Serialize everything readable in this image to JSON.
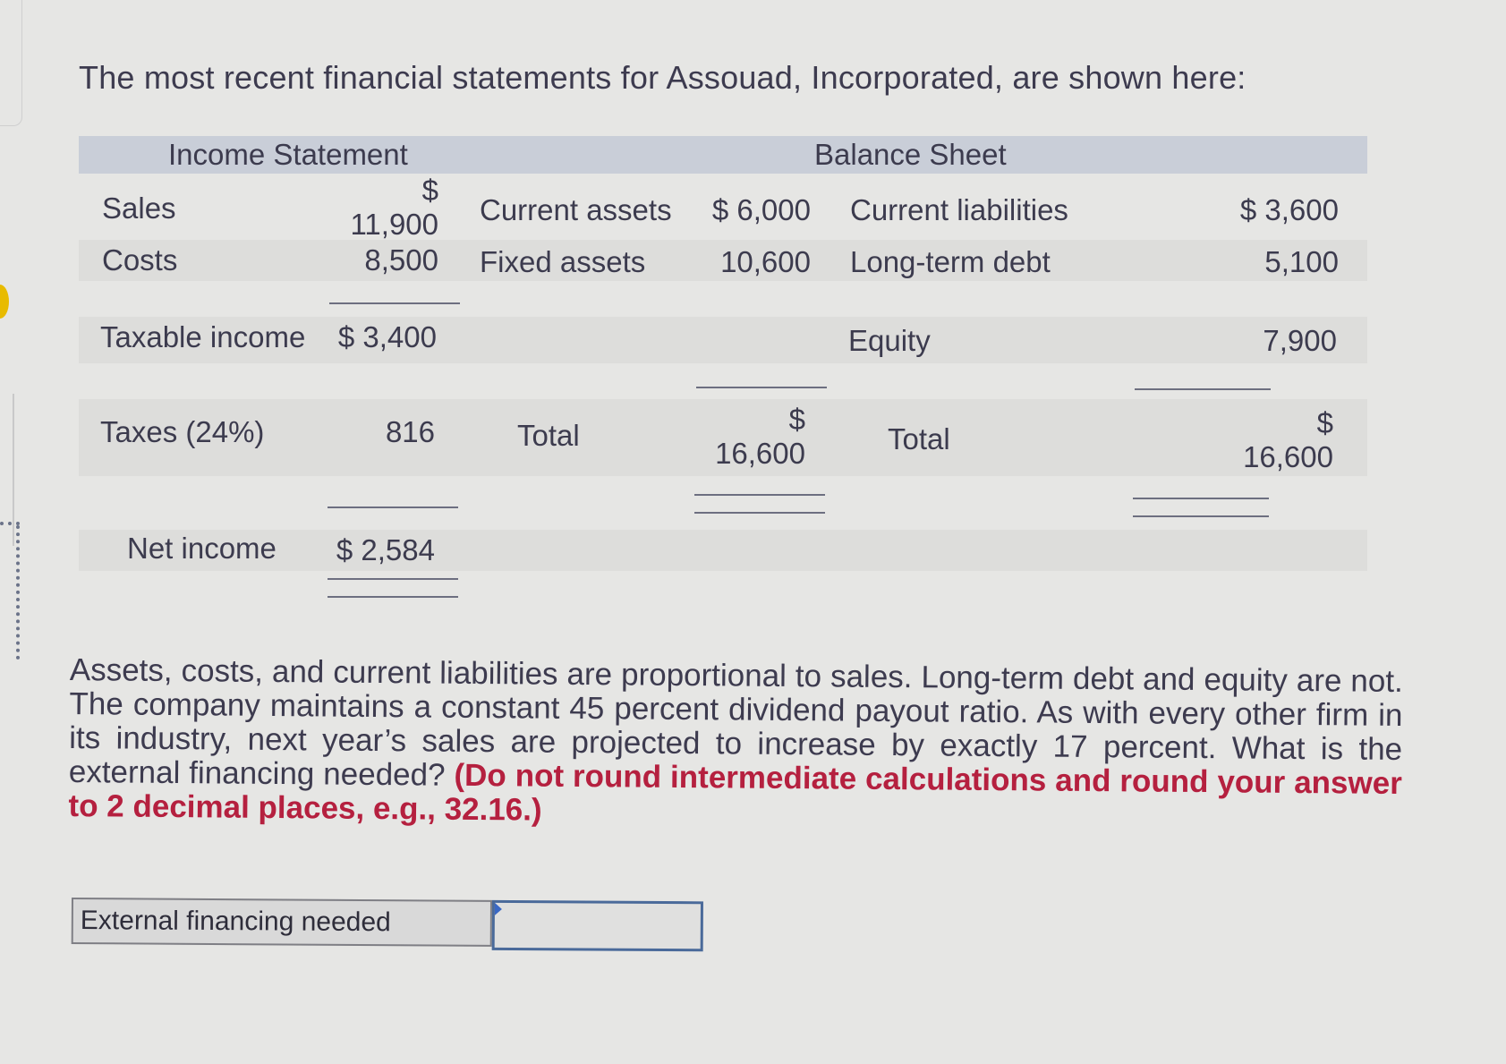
{
  "intro": "The most recent financial statements for Assouad, Incorporated, are shown here:",
  "income_statement": {
    "header": "Income Statement",
    "rows": [
      {
        "label": "Sales",
        "currency": "$",
        "value": "11,900"
      },
      {
        "label": "Costs",
        "value": "8,500"
      },
      {
        "label": "Taxable income",
        "value": "$ 3,400"
      },
      {
        "label": "Taxes (24%)",
        "value": "816"
      },
      {
        "label": "Net income",
        "value": "$ 2,584"
      }
    ]
  },
  "balance_sheet": {
    "header": "Balance Sheet",
    "assets": [
      {
        "label": "Current assets",
        "value": "$ 6,000"
      },
      {
        "label": "Fixed assets",
        "value": "10,600"
      }
    ],
    "assets_total": {
      "label": "Total",
      "currency": "$",
      "value": "16,600"
    },
    "liabilities": [
      {
        "label": "Current liabilities",
        "value": "$ 3,600"
      },
      {
        "label": "Long-term debt",
        "value": "5,100"
      },
      {
        "label": "Equity",
        "value": "7,900"
      }
    ],
    "liabilities_total": {
      "label": "Total",
      "currency": "$",
      "value": "16,600"
    }
  },
  "question": {
    "text": "Assets, costs, and current liabilities are proportional to sales. Long-term debt and equity are not. The company maintains a constant 45 percent dividend payout ratio. As with every other firm in its industry, next year’s sales are projected to increase by exactly 17 percent. What is the external financing needed?",
    "hint": "(Do not round intermediate calculations and round your answer to 2 decimal places, e.g., 32.16.)"
  },
  "answer": {
    "label": "External financing needed",
    "value": ""
  },
  "colors": {
    "header_bg": "#c9ced8",
    "hint_red": "#b5203f",
    "input_border": "#4a6a9a"
  }
}
